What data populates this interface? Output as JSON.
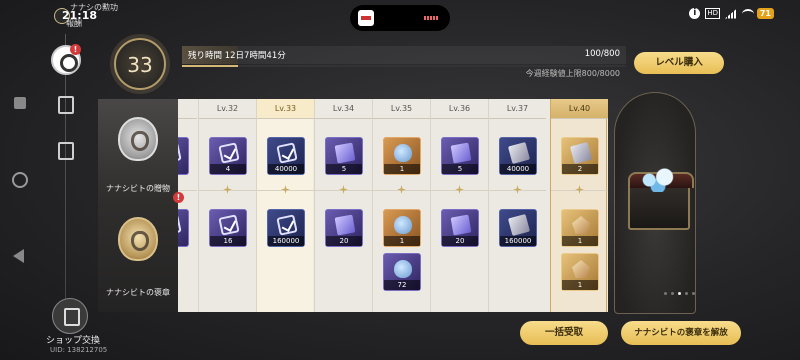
{
  "status_bar": {
    "time": "21:18",
    "subtitle": "ナナシの勲功",
    "label2": "報酬",
    "battery": "71"
  },
  "header": {
    "level": "33",
    "remaining_text": "残り時間 12日7時間41分",
    "progress_text": "100/800",
    "progress_fraction": 0.125,
    "weekly_cap": "今週経験値上限800/8000",
    "buy_level_label": "レベル購入"
  },
  "rows": [
    {
      "label": "ナナシビトの贈物",
      "badge": "!"
    },
    {
      "label": "ナナシビトの褒章"
    }
  ],
  "columns": [
    {
      "level": "",
      "partial": true,
      "top": [
        {
          "rarity": "purple",
          "glyph": "check",
          "count": ""
        }
      ],
      "bottom": [
        {
          "rarity": "purple",
          "glyph": "check",
          "count": ""
        }
      ]
    },
    {
      "level": "Lv.32",
      "top": [
        {
          "rarity": "purple",
          "glyph": "check",
          "count": "4"
        }
      ],
      "bottom": [
        {
          "rarity": "purple",
          "glyph": "check",
          "count": "16"
        }
      ]
    },
    {
      "level": "Lv.33",
      "current": true,
      "top": [
        {
          "rarity": "blue",
          "glyph": "check",
          "count": "40000"
        }
      ],
      "bottom": [
        {
          "rarity": "blue",
          "glyph": "check",
          "count": "160000"
        }
      ]
    },
    {
      "level": "Lv.34",
      "top": [
        {
          "rarity": "purple",
          "glyph": "card",
          "count": "5"
        }
      ],
      "bottom": [
        {
          "rarity": "purple",
          "glyph": "card",
          "count": "20"
        }
      ]
    },
    {
      "level": "Lv.35",
      "top": [
        {
          "rarity": "gold",
          "glyph": "flask",
          "count": "1"
        }
      ],
      "bottom": [
        {
          "rarity": "gold",
          "glyph": "flask",
          "count": "1"
        },
        {
          "rarity": "purple",
          "glyph": "flask",
          "count": "72"
        }
      ]
    },
    {
      "level": "Lv.36",
      "top": [
        {
          "rarity": "purple",
          "glyph": "card",
          "count": "5"
        }
      ],
      "bottom": [
        {
          "rarity": "purple",
          "glyph": "card",
          "count": "20"
        }
      ]
    },
    {
      "level": "Lv.37",
      "top": [
        {
          "rarity": "blue",
          "glyph": "silver",
          "count": "40000"
        }
      ],
      "bottom": [
        {
          "rarity": "blue",
          "glyph": "silver",
          "count": "160000"
        }
      ]
    },
    {
      "level": "Lv.40",
      "final": true,
      "top": [
        {
          "rarity": "gold2",
          "glyph": "silver",
          "count": "2"
        }
      ],
      "bottom": [
        {
          "rarity": "gold2",
          "glyph": "gem",
          "count": "1"
        },
        {
          "rarity": "gold2",
          "glyph": "gem",
          "count": "1"
        }
      ]
    }
  ],
  "sidebar": {
    "shop_label": "ショップ交換",
    "uid": "UID: 138212705"
  },
  "footer": {
    "claim_all_label": "一括受取",
    "unlock_label": "ナナシビトの褒章を解放"
  },
  "carousel": {
    "count": 5,
    "active": 2
  },
  "colors": {
    "accent_gold": "#e8be55",
    "badge_red": "#d43a3a",
    "panel_bg": "#ece9e2"
  }
}
